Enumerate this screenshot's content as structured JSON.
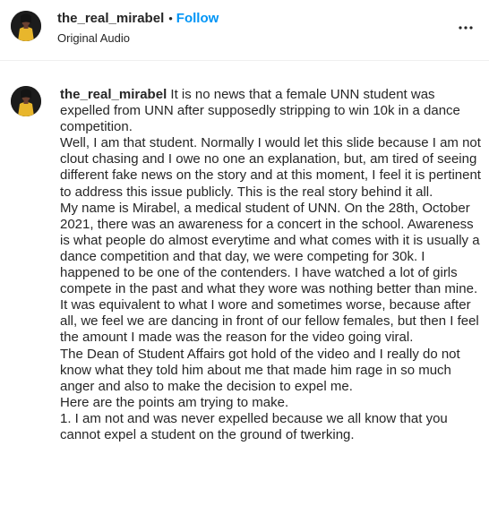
{
  "header": {
    "username": "the_real_mirabel",
    "separator": "•",
    "follow_label": "Follow",
    "audio_label": "Original Audio",
    "more_icon": "more-horizontal-icon"
  },
  "comment": {
    "username": "the_real_mirabel",
    "first_line": "It is no news that a female UNN student was expelled from UNN after supposedly stripping to win 10k in a dance competition.",
    "paragraphs": [
      "Well, I am that student. Normally I would let this slide because I am not clout chasing and I owe no one an explanation, but, am tired of seeing different fake news on the story and at this moment, I feel it is pertinent to address this issue publicly. This is the real story behind it all.",
      "My name is Mirabel, a medical student of UNN. On the 28th, October 2021, there was an awareness for a concert in the school. Awareness is what people do almost everytime and what comes with it is usually a dance competition and that day, we were competing for 30k. I happened to be one of the contenders. I have watched a lot of girls compete in the past and what they wore was nothing better than mine. It was equivalent to what I wore and sometimes worse, because after all, we feel we are dancing in front of our fellow females, but then I feel the amount I made was the reason for the video going viral.",
      "The Dean of Student Affairs got hold of the video and I really do not know what they told him about me that made him rage in so much anger and also to make the decision to expel me.",
      "Here are the points am trying to make.",
      "1. I am not and was never expelled because we all know that you cannot expel a student on the ground of twerking."
    ]
  },
  "colors": {
    "text": "#262626",
    "follow": "#0095f6",
    "divider": "#efefef",
    "avatar_bg": "#1a1a1a",
    "avatar_outfit": "#e8b62c"
  }
}
